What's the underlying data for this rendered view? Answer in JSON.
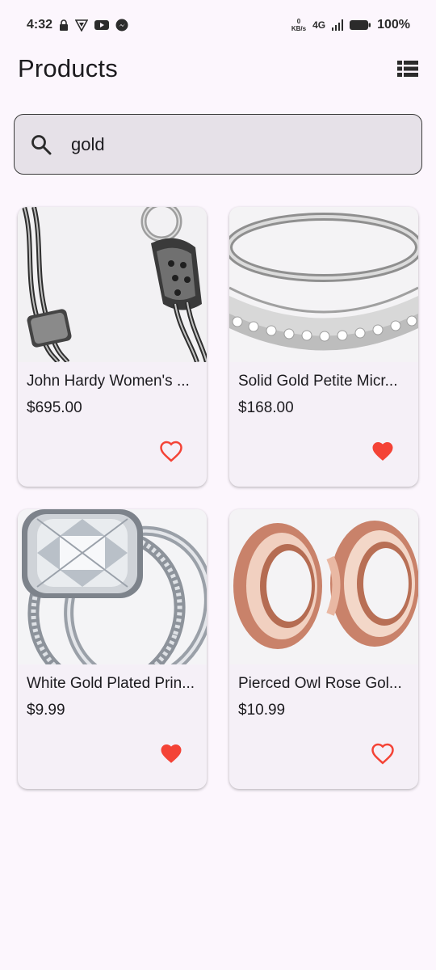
{
  "status_bar": {
    "time": "4:32",
    "net_speed_value": "0",
    "net_speed_unit": "KB/s",
    "network": "4G",
    "battery": "100%",
    "icons": [
      "lock-icon",
      "vpn-icon",
      "youtube-icon",
      "messenger-icon",
      "signal-icon",
      "battery-icon"
    ]
  },
  "app_bar": {
    "title": "Products",
    "view_toggle_icon": "list-view-icon"
  },
  "search": {
    "value": "gold",
    "icon": "search-icon"
  },
  "products": [
    {
      "name": "John Hardy Women's ...",
      "price": "$695.00",
      "favorite": false
    },
    {
      "name": "Solid Gold Petite Micr...",
      "price": "$168.00",
      "favorite": true
    },
    {
      "name": "White Gold Plated Prin...",
      "price": "$9.99",
      "favorite": true
    },
    {
      "name": "Pierced Owl Rose Gol...",
      "price": "$10.99",
      "favorite": false
    }
  ],
  "colors": {
    "background": "#fcf6fd",
    "card": "#f5f0f7",
    "search_fill": "#e6e1e8",
    "favorite_red": "#f44336"
  }
}
